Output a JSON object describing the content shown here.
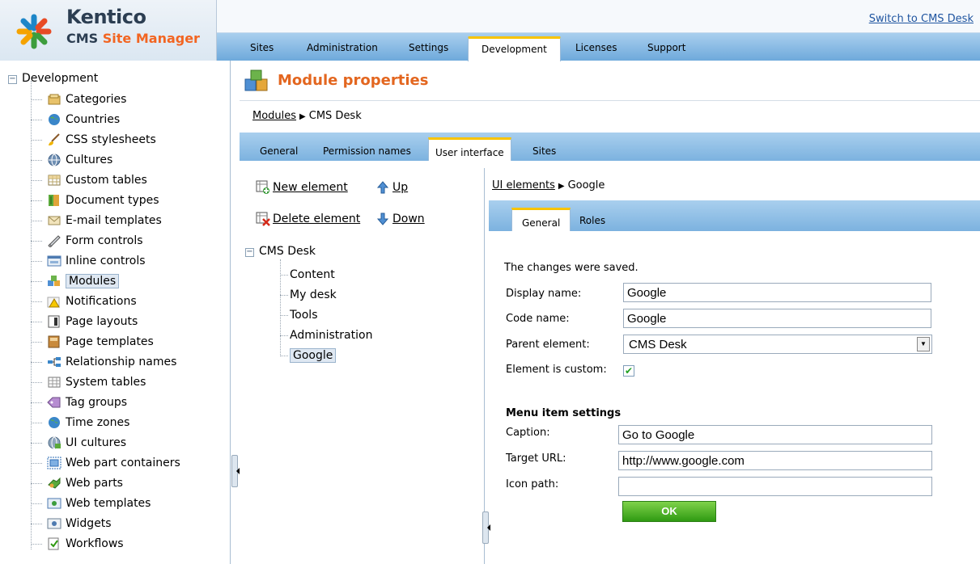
{
  "logo": {
    "brand": "Kentico",
    "sub_cms": "CMS",
    "sub_sm": "Site Manager"
  },
  "topbar": {
    "switch_link": "Switch to CMS Desk"
  },
  "main_tabs": [
    "Sites",
    "Administration",
    "Settings",
    "Development",
    "Licenses",
    "Support"
  ],
  "main_tab_active": "Development",
  "tree": {
    "root": "Development",
    "items": [
      {
        "label": "Categories",
        "icon": "categories-icon"
      },
      {
        "label": "Countries",
        "icon": "globe-icon"
      },
      {
        "label": "CSS stylesheets",
        "icon": "brush-icon"
      },
      {
        "label": "Cultures",
        "icon": "culture-globe-icon"
      },
      {
        "label": "Custom tables",
        "icon": "table-icon"
      },
      {
        "label": "Document types",
        "icon": "book-icon"
      },
      {
        "label": "E-mail templates",
        "icon": "envelope-icon"
      },
      {
        "label": "Form controls",
        "icon": "form-control-icon"
      },
      {
        "label": "Inline controls",
        "icon": "inline-control-icon"
      },
      {
        "label": "Modules",
        "icon": "modules-icon"
      },
      {
        "label": "Notifications",
        "icon": "warning-icon"
      },
      {
        "label": "Page layouts",
        "icon": "page-layout-icon"
      },
      {
        "label": "Page templates",
        "icon": "page-template-icon"
      },
      {
        "label": "Relationship names",
        "icon": "relationship-icon"
      },
      {
        "label": "System tables",
        "icon": "system-table-icon"
      },
      {
        "label": "Tag groups",
        "icon": "tag-icon"
      },
      {
        "label": "Time zones",
        "icon": "time-zone-icon"
      },
      {
        "label": "UI cultures",
        "icon": "ui-culture-icon"
      },
      {
        "label": "Web part containers",
        "icon": "container-icon"
      },
      {
        "label": "Web parts",
        "icon": "webparts-icon"
      },
      {
        "label": "Web templates",
        "icon": "web-template-icon"
      },
      {
        "label": "Widgets",
        "icon": "widget-icon"
      },
      {
        "label": "Workflows",
        "icon": "workflow-icon"
      }
    ],
    "selected": "Modules"
  },
  "page": {
    "title": "Module properties"
  },
  "breadcrumb": {
    "link": "Modules",
    "current": "CMS Desk"
  },
  "sub_tabs": [
    "General",
    "Permission names",
    "User interface",
    "Sites"
  ],
  "sub_tab_active": "User interface",
  "actions": {
    "new_element": "New element",
    "up": "Up",
    "delete_element": "Delete element",
    "down": "Down"
  },
  "ui_tree": {
    "root": "CMS Desk",
    "items": [
      "Content",
      "My desk",
      "Tools",
      "Administration",
      "Google"
    ],
    "selected": "Google"
  },
  "right_breadcrumb": {
    "link": "UI elements",
    "current": "Google"
  },
  "element_tabs": [
    "General",
    "Roles"
  ],
  "element_tab_active": "General",
  "form": {
    "message": "The changes were saved.",
    "display_name_label": "Display name:",
    "display_name": "Google",
    "code_name_label": "Code name:",
    "code_name": "Google",
    "parent_label": "Parent element:",
    "parent_value": "CMS Desk",
    "custom_label": "Element is custom:",
    "custom_checked": true,
    "menu_section": "Menu item settings",
    "caption_label": "Caption:",
    "caption": "Go to Google",
    "target_label": "Target URL:",
    "target": "http://www.google.com",
    "icon_label": "Icon path:",
    "icon_path": "",
    "ok": "OK"
  },
  "colors": {
    "accent_orange": "#e3661f",
    "tab_blue": "#7cb2df",
    "tab_active_border": "#f8c400",
    "ok_green": "#2f9a12"
  }
}
